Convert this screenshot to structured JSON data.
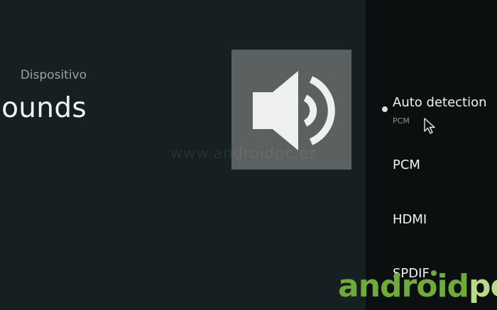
{
  "header": {
    "breadcrumb": "Dispositivo",
    "title": "Digital sounds"
  },
  "hero": {
    "icon": "speaker-volume-icon"
  },
  "watermark": {
    "text": "www.androidpc.es"
  },
  "options": {
    "items": [
      {
        "label": "Auto detection",
        "sublabel": "PCM",
        "selected": true
      },
      {
        "label": "PCM"
      },
      {
        "label": "HDMI"
      },
      {
        "label": "SPDIF"
      }
    ]
  },
  "logo": {
    "part1": "android",
    "part2": "pc"
  },
  "colors": {
    "left_background": "#162022",
    "right_background": "#0c0f10",
    "hero_tile": "#5a6160",
    "logo_green": "#6faa3a",
    "logo_light_green": "#b8d98a"
  }
}
